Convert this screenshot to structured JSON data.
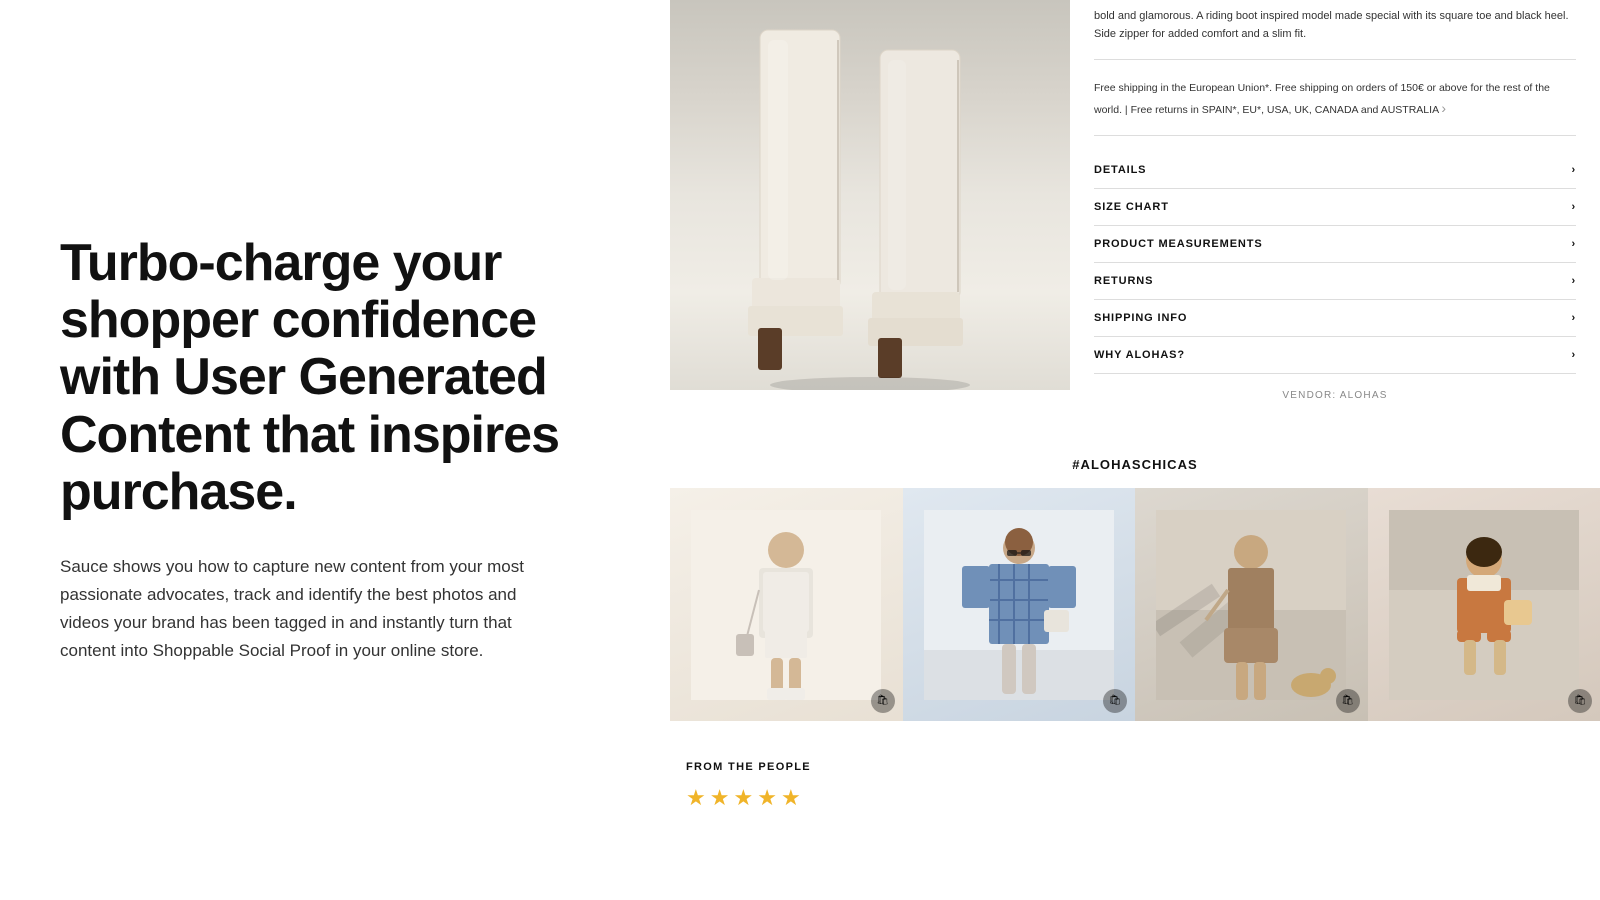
{
  "left": {
    "headline": "Turbo-charge your shopper confidence with User Generated Content that inspires purchase.",
    "body": "Sauce shows you how to capture new content from your most passionate advocates, track and identify the best photos and videos your brand has been tagged in and instantly turn that content into Shoppable Social Proof in your online store."
  },
  "product": {
    "description": "bold and glamorous. A riding boot inspired model made special with its square toe and black heel. Side zipper for added comfort and a slim fit.",
    "shipping_text": "Free shipping in the European Union*. Free shipping on orders of 150€ or above for the rest of the world. | Free returns in SPAIN*, EU*, USA, UK, CANADA and AUSTRALIA",
    "shipping_arrow": "›",
    "accordion": [
      {
        "label": "DETAILS",
        "arrow": "›"
      },
      {
        "label": "SIZE CHART",
        "arrow": "›"
      },
      {
        "label": "PRODUCT MEASUREMENTS",
        "arrow": "›"
      },
      {
        "label": "RETURNS",
        "arrow": "›"
      },
      {
        "label": "SHIPPING INFO",
        "arrow": "›"
      },
      {
        "label": "WHY ALOHAS?",
        "arrow": "›"
      }
    ],
    "vendor_label": "VENDOR: ALOHAS"
  },
  "ugc": {
    "hashtag": "#ALOHASCHICAS",
    "photos": [
      {
        "id": 1,
        "alt": "UGC photo 1 - woman in white boots"
      },
      {
        "id": 2,
        "alt": "UGC photo 2 - woman in patterned dress"
      },
      {
        "id": 3,
        "alt": "UGC photo 3 - woman in brown outfit"
      },
      {
        "id": 4,
        "alt": "UGC photo 4 - woman sitting outdoors"
      }
    ]
  },
  "reviews": {
    "section_label": "FROM THE PEOPLE",
    "stars": 5,
    "star_char": "★"
  }
}
